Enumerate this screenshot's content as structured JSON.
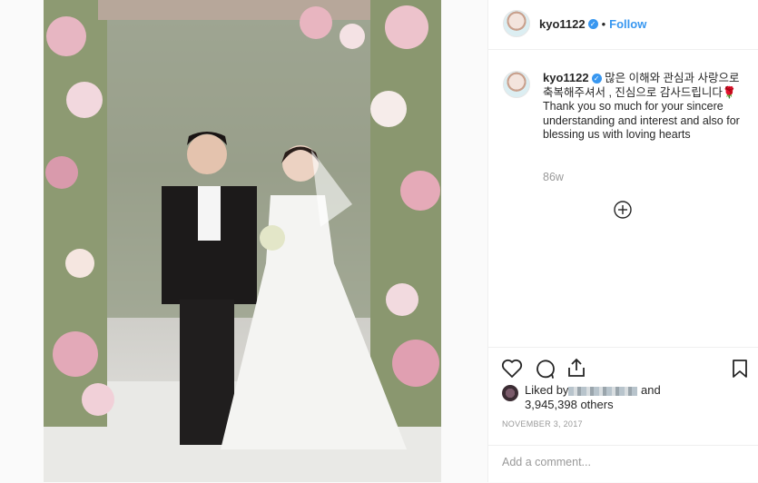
{
  "post": {
    "username": "kyo1122",
    "follow_label": "Follow",
    "dot": "•",
    "caption_text": "많은 이해와 관심과 사랑으로 축복해주셔서 , 진심으로 감사드립니다🌹 Thank you so much for your sincere understanding and interest and also for blessing us with loving hearts",
    "age": "86w",
    "liked_by_prefix": "Liked by",
    "liked_by_suffix": "and",
    "likes_count": "3,945,398 others",
    "date": "NOVEMBER 3, 2017",
    "comment_placeholder": "Add a comment..."
  },
  "icons": {
    "like": "heart-icon",
    "comment": "comment-icon",
    "share": "share-icon",
    "save": "bookmark-icon",
    "verified": "verified-badge-icon",
    "load_more": "plus-circle-icon"
  },
  "colors": {
    "link": "#3897f0",
    "text": "#262626",
    "muted": "#999999",
    "border": "#efefef"
  }
}
